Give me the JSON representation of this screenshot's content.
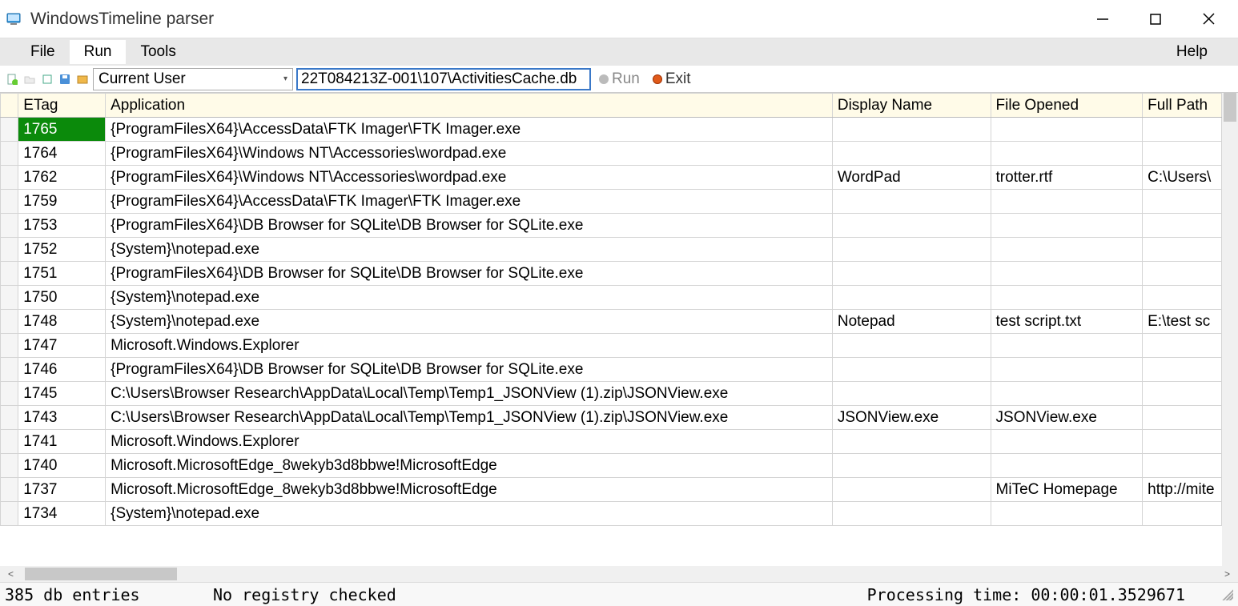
{
  "window": {
    "title": "WindowsTimeline parser"
  },
  "menu": {
    "file": "File",
    "run": "Run",
    "tools": "Tools",
    "help": "Help"
  },
  "toolbar": {
    "user_select": "Current User",
    "path_value": "22T084213Z-001\\107\\ActivitiesCache.db",
    "run_label": "Run",
    "exit_label": "Exit"
  },
  "columns": {
    "etag": "ETag",
    "application": "Application",
    "display_name": "Display Name",
    "file_opened": "File Opened",
    "full_path": "Full Path"
  },
  "rows": [
    {
      "etag": "1765",
      "application": "{ProgramFilesX64}\\AccessData\\FTK Imager\\FTK Imager.exe",
      "display": "",
      "file": "",
      "full": "",
      "selected": true
    },
    {
      "etag": "1764",
      "application": "{ProgramFilesX64}\\Windows NT\\Accessories\\wordpad.exe",
      "display": "",
      "file": "",
      "full": ""
    },
    {
      "etag": "1762",
      "application": "{ProgramFilesX64}\\Windows NT\\Accessories\\wordpad.exe",
      "display": "WordPad",
      "file": "trotter.rtf",
      "full": "C:\\Users\\"
    },
    {
      "etag": "1759",
      "application": "{ProgramFilesX64}\\AccessData\\FTK Imager\\FTK Imager.exe",
      "display": "",
      "file": "",
      "full": ""
    },
    {
      "etag": "1753",
      "application": "{ProgramFilesX64}\\DB Browser for SQLite\\DB Browser for SQLite.exe",
      "display": "",
      "file": "",
      "full": ""
    },
    {
      "etag": "1752",
      "application": "{System}\\notepad.exe",
      "display": "",
      "file": "",
      "full": ""
    },
    {
      "etag": "1751",
      "application": "{ProgramFilesX64}\\DB Browser for SQLite\\DB Browser for SQLite.exe",
      "display": "",
      "file": "",
      "full": ""
    },
    {
      "etag": "1750",
      "application": "{System}\\notepad.exe",
      "display": "",
      "file": "",
      "full": ""
    },
    {
      "etag": "1748",
      "application": "{System}\\notepad.exe",
      "display": "Notepad",
      "file": "test script.txt",
      "full": "E:\\test sc"
    },
    {
      "etag": "1747",
      "application": "Microsoft.Windows.Explorer",
      "display": "",
      "file": "",
      "full": ""
    },
    {
      "etag": "1746",
      "application": "{ProgramFilesX64}\\DB Browser for SQLite\\DB Browser for SQLite.exe",
      "display": "",
      "file": "",
      "full": ""
    },
    {
      "etag": "1745",
      "application": "C:\\Users\\Browser Research\\AppData\\Local\\Temp\\Temp1_JSONView (1).zip\\JSONView.exe",
      "display": "",
      "file": "",
      "full": ""
    },
    {
      "etag": "1743",
      "application": "C:\\Users\\Browser Research\\AppData\\Local\\Temp\\Temp1_JSONView (1).zip\\JSONView.exe",
      "display": "JSONView.exe",
      "file": "JSONView.exe",
      "full": ""
    },
    {
      "etag": "1741",
      "application": "Microsoft.Windows.Explorer",
      "display": "",
      "file": "",
      "full": ""
    },
    {
      "etag": "1740",
      "application": "Microsoft.MicrosoftEdge_8wekyb3d8bbwe!MicrosoftEdge",
      "display": "",
      "file": "",
      "full": ""
    },
    {
      "etag": "1737",
      "application": "Microsoft.MicrosoftEdge_8wekyb3d8bbwe!MicrosoftEdge",
      "display": "",
      "file": "MiTeC Homepage",
      "full": "http://mite"
    },
    {
      "etag": "1734",
      "application": "{System}\\notepad.exe",
      "display": "",
      "file": "",
      "full": ""
    }
  ],
  "status": {
    "entries": "385 db entries",
    "registry": "No registry checked",
    "proc_time": "Processing time: 00:00:01.3529671"
  }
}
